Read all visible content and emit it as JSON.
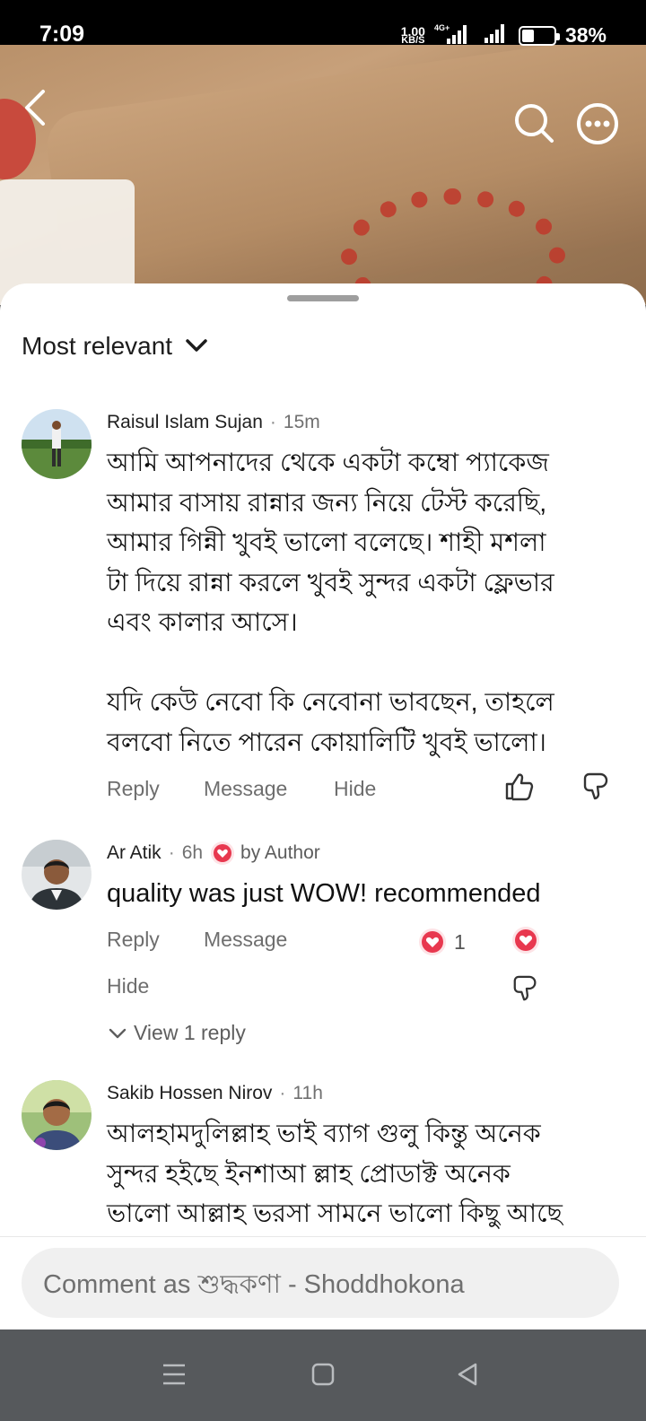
{
  "status_bar": {
    "time": "7:09",
    "net_speed_value": "1.00",
    "net_speed_unit": "KB/S",
    "network_type": "4G+",
    "battery_percent": "38%",
    "battery_level": 0.38
  },
  "header": {
    "back_icon": "chevron-left-icon",
    "search_icon": "search-icon",
    "more_icon": "more-options-icon"
  },
  "sort": {
    "label": "Most relevant"
  },
  "comments": [
    {
      "author": "Raisul Islam Sujan",
      "time": "15m",
      "text": "আমি আপনাদের থেকে একটা কম্বো প্যাকেজ\nআমার বাসায় রান্নার জন্য নিয়ে টেস্ট করেছি,\nআমার গিন্নী খুবই ভালো বলেছে। শাহী মশলা\nটা দিয়ে রান্না করলে খুবই সুন্দর একটা ফ্লেভার\nএবং কালার আসে।\n\nযদি কেউ নেবো কি নেবোনা ভাবছেন, তাহলে\nবলবো নিতে পারেন কোয়ালিটি খুবই ভালো।",
      "actions": {
        "reply": "Reply",
        "message": "Message",
        "hide": "Hide"
      }
    },
    {
      "author": "Ar Atik",
      "time": "6h",
      "author_badge": "by Author",
      "text": "quality was just WOW! recommended",
      "reaction_count": "1",
      "actions": {
        "reply": "Reply",
        "message": "Message",
        "hide": "Hide"
      },
      "view_replies": "View 1 reply"
    },
    {
      "author": "Sakib Hossen Nirov",
      "time": "11h",
      "text": "আলহামদুলিল্লাহ ভাই ব্যাগ গুলু কিন্তু অনেক\nসুন্দর হইছে ইনশাআ ল্লাহ প্রোডাক্ট অনেক\nভালো আল্লাহ ভরসা সামনে ভালো কিছু আছে"
    }
  ],
  "composer": {
    "placeholder": "Comment as শুদ্ধকণা - Shoddhokona"
  },
  "colors": {
    "accent_heart": "#e8384f",
    "nav_bar": "#56595c"
  }
}
